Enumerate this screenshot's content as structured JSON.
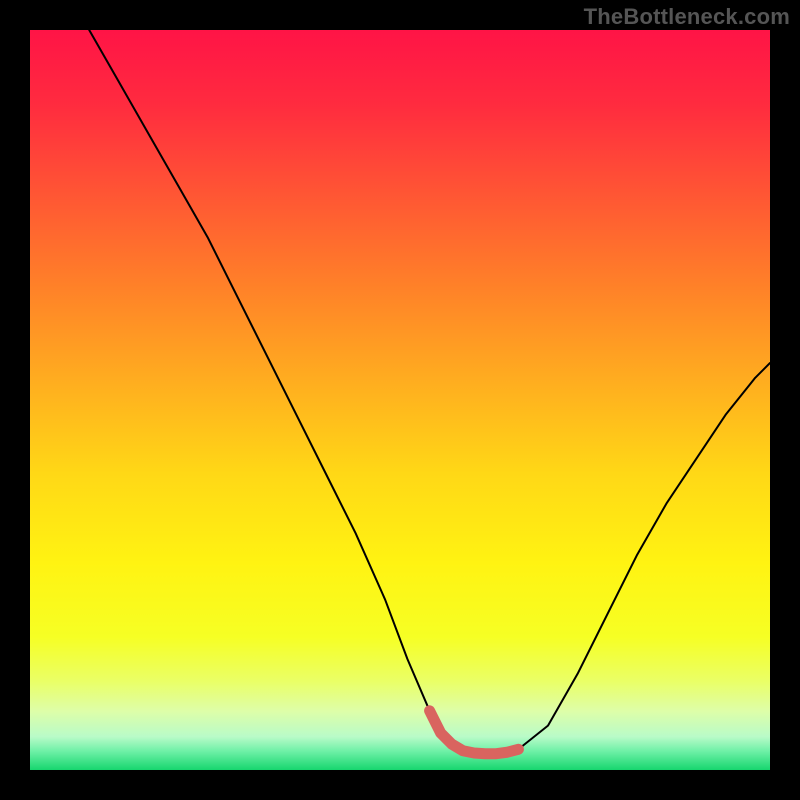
{
  "watermark": "TheBottleneck.com",
  "colors": {
    "frame": "#000000",
    "gradient_stops": [
      {
        "offset": 0.0,
        "color": "#ff1446"
      },
      {
        "offset": 0.1,
        "color": "#ff2b3f"
      },
      {
        "offset": 0.22,
        "color": "#ff5534"
      },
      {
        "offset": 0.35,
        "color": "#ff8228"
      },
      {
        "offset": 0.48,
        "color": "#ffaf1f"
      },
      {
        "offset": 0.6,
        "color": "#ffd816"
      },
      {
        "offset": 0.72,
        "color": "#fff312"
      },
      {
        "offset": 0.82,
        "color": "#f6ff24"
      },
      {
        "offset": 0.88,
        "color": "#eaff66"
      },
      {
        "offset": 0.92,
        "color": "#defea8"
      },
      {
        "offset": 0.955,
        "color": "#b9fbc8"
      },
      {
        "offset": 0.975,
        "color": "#6df0a6"
      },
      {
        "offset": 1.0,
        "color": "#17d66e"
      }
    ],
    "curve_stroke": "#000000",
    "highlight_stroke": "#d9645f"
  },
  "chart_data": {
    "type": "line",
    "title": "",
    "xlabel": "",
    "ylabel": "",
    "xlim": [
      0,
      100
    ],
    "ylim": [
      0,
      100
    ],
    "annotations": [],
    "series": [
      {
        "name": "bottleneck-curve",
        "x": [
          8,
          12,
          16,
          20,
          24,
          28,
          32,
          36,
          40,
          44,
          48,
          51,
          54,
          57,
          60,
          63,
          66,
          70,
          74,
          78,
          82,
          86,
          90,
          94,
          98,
          100
        ],
        "y": [
          100,
          93,
          86,
          79,
          72,
          64,
          56,
          48,
          40,
          32,
          23,
          15,
          8,
          3.5,
          2.3,
          2.2,
          2.8,
          6,
          13,
          21,
          29,
          36,
          42,
          48,
          53,
          55
        ]
      },
      {
        "name": "optimal-range-highlight",
        "x": [
          54,
          55.5,
          57,
          58.5,
          60,
          61.5,
          63,
          64.5,
          66
        ],
        "y": [
          8,
          5,
          3.5,
          2.6,
          2.3,
          2.2,
          2.2,
          2.4,
          2.8
        ]
      }
    ]
  }
}
